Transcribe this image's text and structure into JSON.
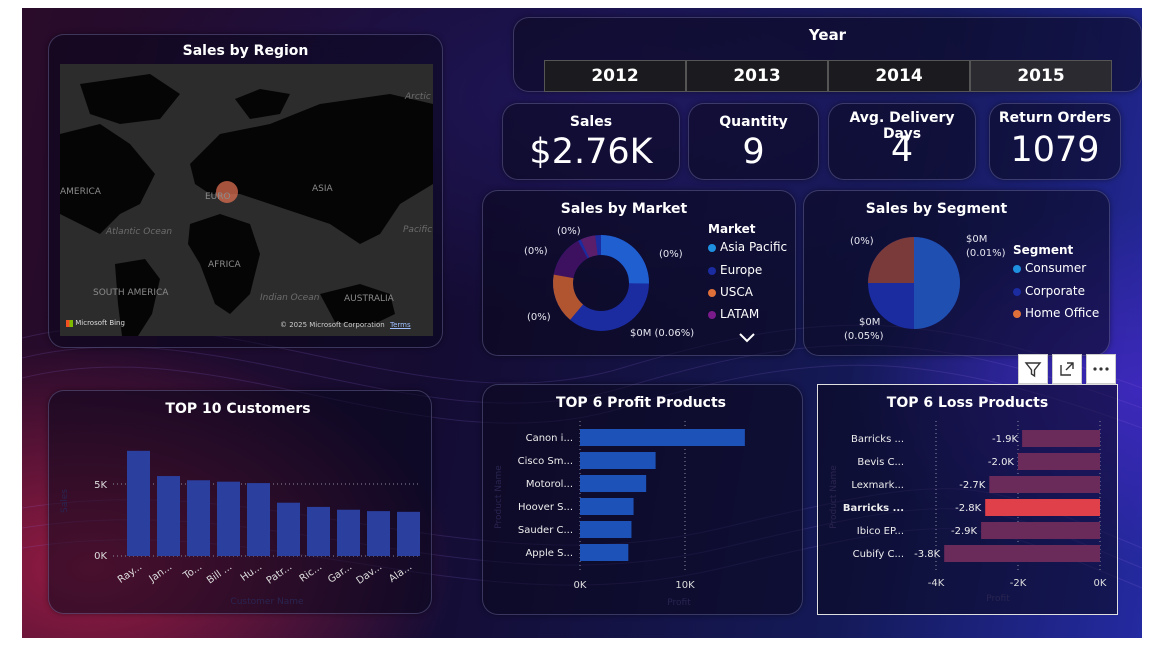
{
  "year_slicer": {
    "title": "Year",
    "options": [
      "2012",
      "2013",
      "2014",
      "2015"
    ]
  },
  "kpis": [
    {
      "label": "Sales",
      "value": "$2.76K"
    },
    {
      "label": "Quantity",
      "value": "9"
    },
    {
      "label": "Avg. Delivery Days",
      "value": "4"
    },
    {
      "label": "Return Orders",
      "value": "1079"
    }
  ],
  "map": {
    "title": "Sales by Region",
    "labels": {
      "america": "AMERICA",
      "europe": "EURO",
      "asia": "ASIA",
      "africa": "AFRICA",
      "south_america": "SOUTH AMERICA",
      "australia": "AUSTRALIA",
      "arctic": "Arctic",
      "atlantic": "Atlantic Ocean",
      "indian": "Indian Ocean",
      "pacific": "Pacific"
    },
    "bing_logo": "Microsoft Bing",
    "copyright": "© 2025 Microsoft Corporation",
    "terms": "Terms"
  },
  "market": {
    "title": "Sales by Market",
    "legend_title": "Market",
    "legend": [
      {
        "name": "Asia Pacific",
        "color": "#1f8fe0"
      },
      {
        "name": "Europe",
        "color": "#1b2ba0"
      },
      {
        "name": "USCA",
        "color": "#e0703a"
      },
      {
        "name": "LATAM",
        "color": "#7b1a8a"
      }
    ],
    "slice_labels": [
      "(0%)",
      "(0%)",
      "(0%)",
      "(0%)",
      "$0M (0.06%)"
    ],
    "more_icon": "chevron-down-icon"
  },
  "segment": {
    "title": "Sales by Segment",
    "legend_title": "Segment",
    "legend": [
      {
        "name": "Consumer",
        "color": "#1f8fe0"
      },
      {
        "name": "Corporate",
        "color": "#1b2ba0"
      },
      {
        "name": "Home Office",
        "color": "#e0703a"
      }
    ],
    "slice_labels": [
      "(0%)",
      "$0M",
      "(0.01%)",
      "$0M",
      "(0.05%)"
    ]
  },
  "visual_toolbar": {
    "filter_icon": "filter-icon",
    "focus_icon": "focus-mode-icon",
    "more_icon": "more-options-icon"
  },
  "top_customers": {
    "title": "TOP 10 Customers",
    "ylabel": "Sales",
    "xlabel": "Customer Name",
    "yticks": [
      "5K",
      "0K"
    ],
    "bar_color": "#2a3f9e",
    "chart_data": {
      "type": "bar",
      "categories": [
        "Ray...",
        "Jan...",
        "To...",
        "Bill ...",
        "Hu...",
        "Patr...",
        "Ric...",
        "Gar...",
        "Dav...",
        "Ala..."
      ],
      "values": [
        7500,
        5700,
        5400,
        5300,
        5200,
        3800,
        3500,
        3300,
        3200,
        3150
      ],
      "ylim": [
        0,
        8200
      ]
    }
  },
  "profit_products": {
    "title": "TOP 6 Profit Products",
    "ylabel": "Product Name",
    "xlabel": "Profit",
    "xticks": [
      "0K",
      "10K"
    ],
    "bar_color": "#1d53b8",
    "chart_data": {
      "type": "bar",
      "categories": [
        "Canon i...",
        "Cisco Sm...",
        "Motorol...",
        "Hoover S...",
        "Sauder C...",
        "Apple S..."
      ],
      "values": [
        15700,
        7200,
        6300,
        5100,
        4900,
        4600
      ],
      "xlim": [
        0,
        17000
      ]
    }
  },
  "loss_products": {
    "title": "TOP 6 Loss Products",
    "ylabel": "Product Name",
    "xlabel": "Profit",
    "xticks": [
      "-4K",
      "-2K",
      "0K"
    ],
    "bar_color": "#6a2a5a",
    "highlight_color": "#e0404a",
    "chart_data": {
      "type": "bar",
      "categories": [
        "Barricks ...",
        "Bevis C...",
        "Lexmark...",
        "Barricks ...",
        "Ibico EP...",
        "Cubify C..."
      ],
      "values": [
        -1.9,
        -2.0,
        -2.7,
        -2.8,
        -2.9,
        -3.8
      ],
      "value_labels": [
        "-1.9K",
        "-2.0K",
        "-2.7K",
        "-2.8K",
        "-2.9K",
        "-3.8K"
      ],
      "highlight_index": 3,
      "xlim": [
        -4.0,
        0
      ]
    }
  }
}
